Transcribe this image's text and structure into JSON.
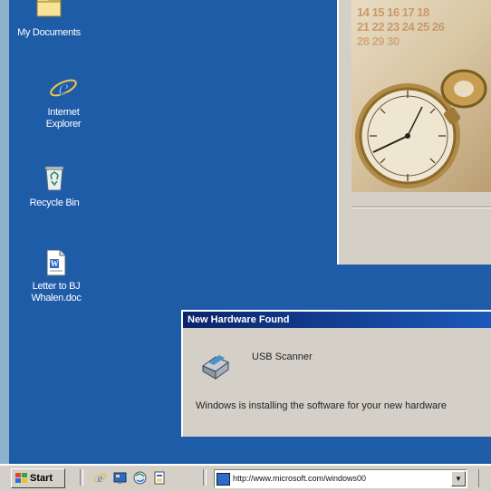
{
  "desktop": {
    "icons": [
      {
        "label": "My Documents",
        "icon": "folder-icon"
      },
      {
        "label": "Internet Explorer",
        "icon": "internet-explorer-icon"
      },
      {
        "label": "Recycle Bin",
        "icon": "recycle-bin-icon"
      },
      {
        "label": "Letter to BJ Whalen.doc",
        "icon": "document-icon"
      }
    ]
  },
  "photo": {
    "calendar_row1": "14 15 16 17 18",
    "calendar_row2": "21 22 23 24 25 26",
    "calendar_row3": "28 29 30"
  },
  "dialog": {
    "title": "New Hardware Found",
    "device": "USB Scanner",
    "message": "Windows is installing the software for your new hardware"
  },
  "taskbar": {
    "start_label": "Start",
    "address_url": "http://www.microsoft.com/windows00",
    "dropdown_glyph": "▼"
  },
  "colors": {
    "desktop": "#1f5ca8",
    "title_bar": "#0a246a",
    "chrome": "#d4d0c8"
  }
}
